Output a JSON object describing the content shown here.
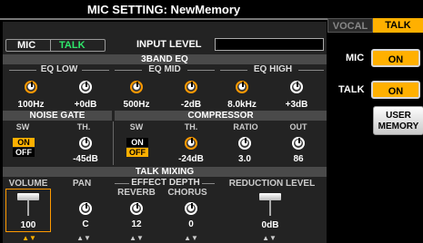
{
  "title": "MIC SETTING: NewMemory",
  "tabs": {
    "vocal": "VOCAL",
    "talk": "TALK"
  },
  "right": {
    "mic_label": "MIC",
    "mic_value": "ON",
    "talk_label": "TALK",
    "talk_value": "ON",
    "user_memory": "USER\nMEMORY"
  },
  "top": {
    "mic": "MIC",
    "talk": "TALK",
    "input_level": "INPUT LEVEL"
  },
  "eq": {
    "title": "3BAND EQ",
    "low": {
      "label": "EQ LOW",
      "freq": "100Hz",
      "gain": "+0dB"
    },
    "mid": {
      "label": "EQ MID",
      "freq": "500Hz",
      "gain": "-2dB"
    },
    "high": {
      "label": "EQ HIGH",
      "freq": "8.0kHz",
      "gain": "+3dB"
    }
  },
  "noise_gate": {
    "title": "NOISE GATE",
    "sw": "SW",
    "th": "TH.",
    "on": "ON",
    "off": "OFF",
    "th_value": "-45dB"
  },
  "compressor": {
    "title": "COMPRESSOR",
    "sw": "SW",
    "th": "TH.",
    "ratio": "RATIO",
    "out": "OUT",
    "on": "ON",
    "off": "OFF",
    "th_value": "-24dB",
    "ratio_value": "3.0",
    "out_value": "86"
  },
  "talk_mixing": {
    "title": "TALK MIXING",
    "volume": "VOLUME",
    "pan": "PAN",
    "effect_depth": "EFFECT DEPTH",
    "reverb": "REVERB",
    "chorus": "CHORUS",
    "reduction_level": "REDUCTION LEVEL",
    "volume_value": "100",
    "pan_value": "C",
    "reverb_value": "12",
    "chorus_value": "0",
    "reduction_value": "0dB"
  },
  "arrows": "▲▼"
}
